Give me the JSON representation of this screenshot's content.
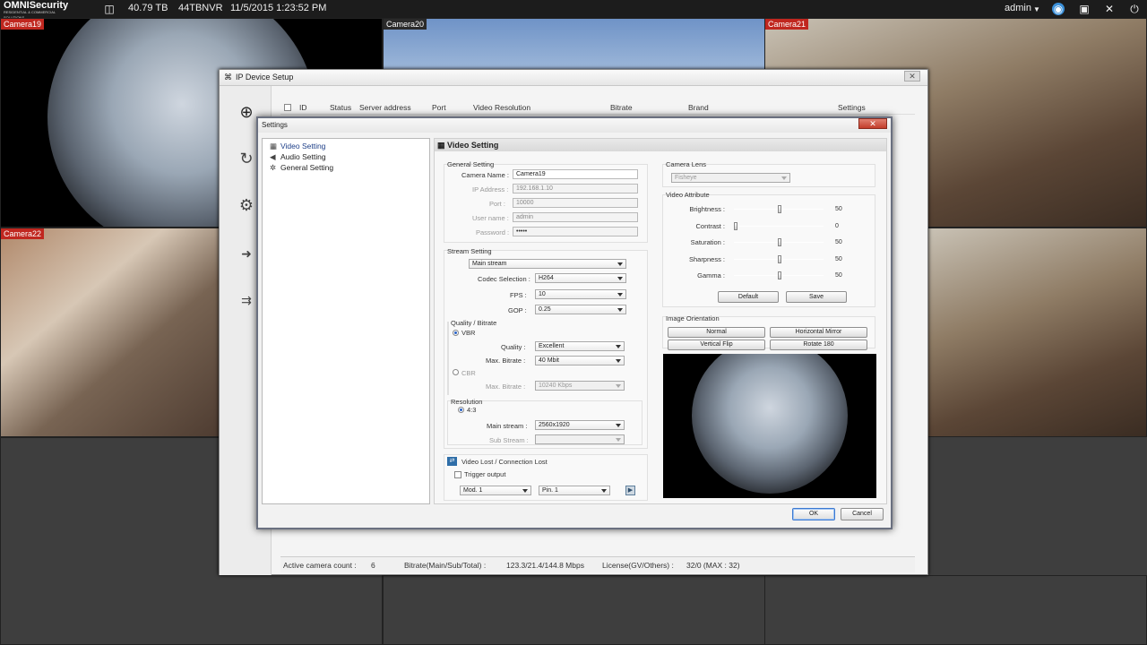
{
  "topbar": {
    "logo_main": "OMNISecurity",
    "logo_sub": "RESIDENTIAL & COMMERCIAL SOLUTIONS",
    "storage": "40.79 TB",
    "nvr": "44TBNVR",
    "datetime": "11/5/2015 1:23:52 PM",
    "user": "admin",
    "icons": [
      "database-icon",
      "eye-icon",
      "save-icon",
      "tools-icon",
      "power-icon"
    ]
  },
  "cameras": [
    {
      "label": "Camera19",
      "accent": "#c0271f"
    },
    {
      "label": "Camera20",
      "accent": "#2a2a2a"
    },
    {
      "label": "Camera21",
      "accent": "#c0271f"
    },
    {
      "label": "Camera22",
      "accent": "#c0271f"
    }
  ],
  "ip_window": {
    "title": "IP Device Setup",
    "columns": [
      "ID",
      "Status",
      "Server address",
      "Port",
      "Video Resolution",
      "Bitrate",
      "Brand",
      "Settings"
    ],
    "status": {
      "active_label": "Active camera count :",
      "active_value": "6",
      "bitrate_label": "Bitrate(Main/Sub/Total) :",
      "bitrate_value": "123.3/21.4/144.8 Mbps",
      "license_label": "License(GV/Others) :",
      "license_value": "32/0 (MAX : 32)"
    }
  },
  "dialog": {
    "title": "Settings",
    "tree": [
      "Video Setting",
      "Audio Setting",
      "General Setting"
    ],
    "panel_title": "Video Setting",
    "general": {
      "title": "General Setting",
      "camera_name_label": "Camera Name :",
      "camera_name": "Camera19",
      "ip_label": "IP Address :",
      "ip": "192.168.1.10",
      "port_label": "Port :",
      "port": "10000",
      "user_label": "User name :",
      "user": "admin",
      "password_label": "Password :",
      "password": "•••••"
    },
    "stream": {
      "title": "Stream Setting",
      "stream_select": "Main stream",
      "codec_label": "Codec Selection :",
      "codec": "H264",
      "fps_label": "FPS :",
      "fps": "10",
      "gop_label": "GOP :",
      "gop": "0.25",
      "quality_title": "Quality / Bitrate",
      "vbr": "VBR",
      "quality_label": "Quality :",
      "quality": "Excellent",
      "max_bitrate_label": "Max. Bitrate :",
      "max_bitrate": "40 Mbit",
      "cbr": "CBR",
      "cbr_max_label": "Max. Bitrate :",
      "cbr_max": "10240 Kbps",
      "resolution_title": "Resolution",
      "aspect": "4:3",
      "main_stream_label": "Main stream :",
      "main_stream": "2560x1920",
      "sub_stream_label": "Sub Stream :",
      "sub_stream": ""
    },
    "videolost": {
      "title": "Video Lost / Connection Lost",
      "trigger": "Trigger output",
      "mod": "Mod. 1",
      "pin": "Pin. 1"
    },
    "lens": {
      "title": "Camera Lens",
      "value": "Fisheye"
    },
    "attributes": {
      "title": "Video Attribute",
      "items": [
        {
          "label": "Brightness :",
          "value": "50",
          "level": 0.5
        },
        {
          "label": "Contrast :",
          "value": "0",
          "level": 0.0
        },
        {
          "label": "Saturation :",
          "value": "50",
          "level": 0.5
        },
        {
          "label": "Sharpness :",
          "value": "50",
          "level": 0.5
        },
        {
          "label": "Gamma :",
          "value": "50",
          "level": 0.5
        }
      ],
      "default_btn": "Default",
      "save_btn": "Save"
    },
    "orientation": {
      "title": "Image Orientation",
      "normal": "Normal",
      "hmirror": "Horizontal Mirror",
      "vflip": "Vertical Flip",
      "rotate": "Rotate 180"
    },
    "ok": "OK",
    "cancel": "Cancel"
  }
}
